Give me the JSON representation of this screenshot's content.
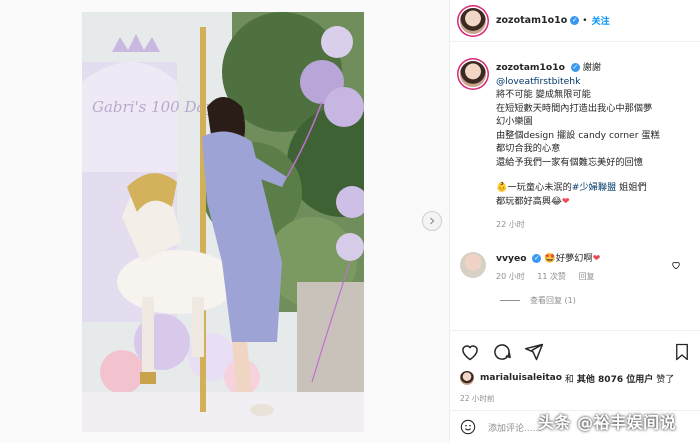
{
  "post": {
    "username": "zozotam1o1o",
    "follow_label": "关注",
    "caption_mention": "@loveatfirstbitehk",
    "caption_first": "謝謝",
    "caption_lines": [
      "將不可能 變成無限可能",
      "在短短數天時間內打造出我心中那個夢",
      "幻小樂園",
      "由整個design 擺設 candy corner 蛋糕",
      "都切合我的心意",
      "還給予我們一家有個難忘美好的回憶"
    ],
    "caption_line2_a": "一玩童心未泯的",
    "caption_hashtag": "#少婦聯盟",
    "caption_line2_b": "姐姐們",
    "caption_line3": "都玩都好高興",
    "caption_time": "22 小时",
    "comment": {
      "username": "vvyeo",
      "text": "好夢幻啊",
      "time": "20 小时",
      "likes": "11 次赞",
      "reply": "回复",
      "view_replies": "查看回复 (1)"
    },
    "likes": {
      "liker": "marialuisaleitao",
      "middle": "和",
      "others": "其他 8076 位用户",
      "suffix": "赞了"
    },
    "time": "22 小时前",
    "add_comment_placeholder": "添加评论......",
    "photo_text": "Gabri's 100 Days"
  },
  "watermark": "头条 @裕丰娱间说",
  "colors": {
    "accent": "#0095f6",
    "heart": "#ed4956"
  }
}
